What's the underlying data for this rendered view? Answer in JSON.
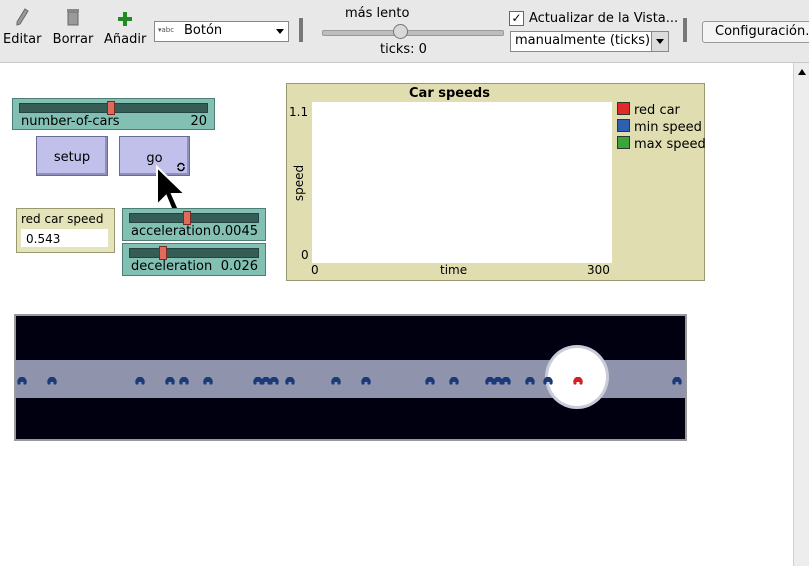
{
  "toolbar": {
    "edit_label": "Editar",
    "delete_label": "Borrar",
    "add_label": "Añadir",
    "widget_type": "Botón",
    "speed_label": "más lento",
    "speed_value": 0.45,
    "ticks_label": "ticks: 0",
    "update_view_label": "Actualizar de la Vista...",
    "update_view_checked": true,
    "update_mode": "manualmente (ticks)",
    "settings_label": "Configuración..."
  },
  "sliders": {
    "number_of_cars": {
      "name": "number-of-cars",
      "value": "20"
    },
    "acceleration": {
      "name": "acceleration",
      "value": "0.0045"
    },
    "deceleration": {
      "name": "deceleration",
      "value": "0.026"
    }
  },
  "buttons": {
    "setup": "setup",
    "go": "go"
  },
  "monitor": {
    "label": "red car speed",
    "value": "0.543"
  },
  "plot": {
    "title": "Car speeds",
    "ylabel": "speed",
    "xlabel": "time",
    "ymax": "1.1",
    "ymin": "0",
    "xmin": "0",
    "xmax": "300",
    "legend": [
      {
        "name": "red car",
        "color": "#e02a2a"
      },
      {
        "name": "min speed",
        "color": "#2f5fb0"
      },
      {
        "name": "max speed",
        "color": "#3aa63a"
      }
    ]
  },
  "world": {
    "background": "#000010",
    "road_color": "#8f93ac",
    "car_color": "#1a3a7a",
    "red_car_color": "#d42020"
  }
}
